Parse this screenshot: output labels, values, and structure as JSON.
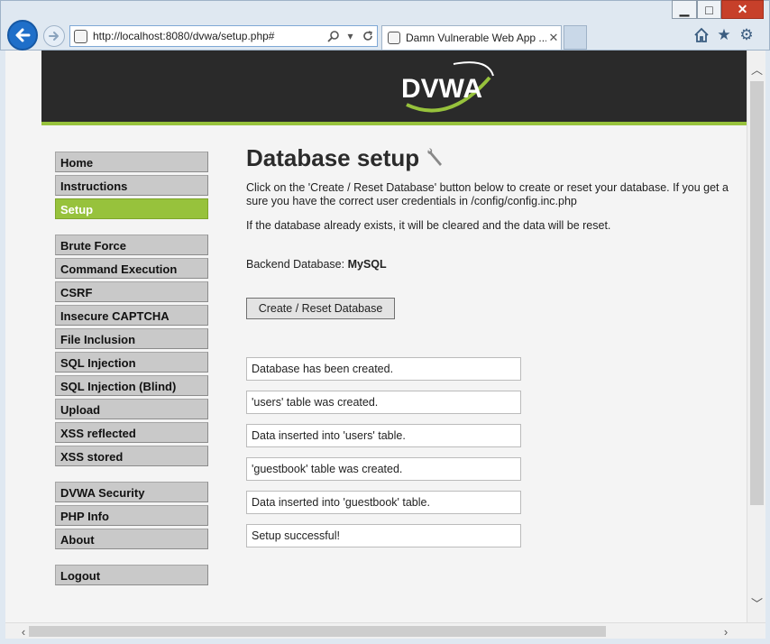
{
  "window": {
    "minimize": "▁",
    "maximize": "□",
    "close": "✕"
  },
  "browser": {
    "url": "http://localhost:8080/dvwa/setup.php#",
    "tab_title": "Damn Vulnerable Web App ...",
    "tab_close": "✕",
    "icons": [
      "home-icon",
      "star-icon",
      "gear-icon",
      "search-icon",
      "refresh-icon",
      "dropdown-icon"
    ]
  },
  "logo": {
    "text": "DVWA",
    "accent": "#97c23c"
  },
  "menu": {
    "group1": [
      {
        "label": "Home"
      },
      {
        "label": "Instructions"
      },
      {
        "label": "Setup",
        "selected": true
      }
    ],
    "group2": [
      {
        "label": "Brute Force"
      },
      {
        "label": "Command Execution"
      },
      {
        "label": "CSRF"
      },
      {
        "label": "Insecure CAPTCHA"
      },
      {
        "label": "File Inclusion"
      },
      {
        "label": "SQL Injection"
      },
      {
        "label": "SQL Injection (Blind)"
      },
      {
        "label": "Upload"
      },
      {
        "label": "XSS reflected"
      },
      {
        "label": "XSS stored"
      }
    ],
    "group3": [
      {
        "label": "DVWA Security"
      },
      {
        "label": "PHP Info"
      },
      {
        "label": "About"
      }
    ],
    "group4": [
      {
        "label": "Logout"
      }
    ]
  },
  "main": {
    "title": "Database setup",
    "para1_line1": "Click on the 'Create / Reset Database' button below to create or reset your database. If you get a",
    "para1_line2": "sure you have the correct user credentials in /config/config.inc.php",
    "para2": "If the database already exists, it will be cleared and the data will be reset.",
    "backend_label": "Backend Database:",
    "backend_value": "MySQL",
    "button_label": "Create / Reset Database",
    "messages": [
      "Database has been created.",
      "'users' table was created.",
      "Data inserted into 'users' table.",
      "'guestbook' table was created.",
      "Data inserted into 'guestbook' table.",
      "Setup successful!"
    ]
  },
  "colors": {
    "header_bg": "#2a2a2a",
    "accent": "#97c23c",
    "menu_bg": "#c9c9c9"
  }
}
